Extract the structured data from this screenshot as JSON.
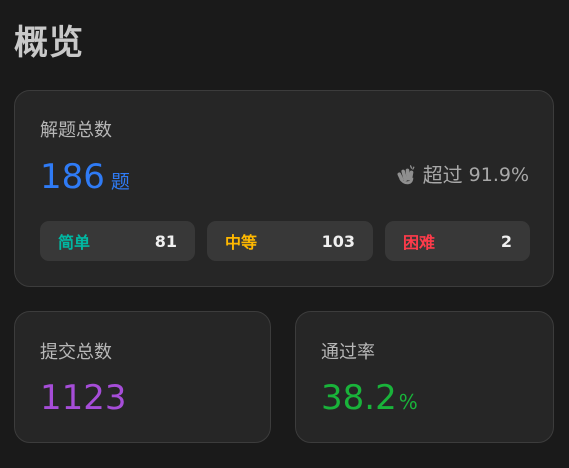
{
  "page": {
    "title": "概览"
  },
  "solved": {
    "label": "解题总数",
    "count": "186",
    "unit": "题",
    "beats_label": "超过",
    "beats_value": "91.9%",
    "beats_icon": "clapping-hands-icon"
  },
  "difficulty": [
    {
      "name": "简单",
      "count": "81",
      "color": "#00b8a3"
    },
    {
      "name": "中等",
      "count": "103",
      "color": "#ffb800"
    },
    {
      "name": "困难",
      "count": "2",
      "color": "#ff3b4a"
    }
  ],
  "submissions": {
    "label": "提交总数",
    "value": "1123",
    "color": "#a64dd8"
  },
  "acceptance": {
    "label": "通过率",
    "value": "38.2",
    "unit": "%",
    "color": "#19b33a"
  }
}
